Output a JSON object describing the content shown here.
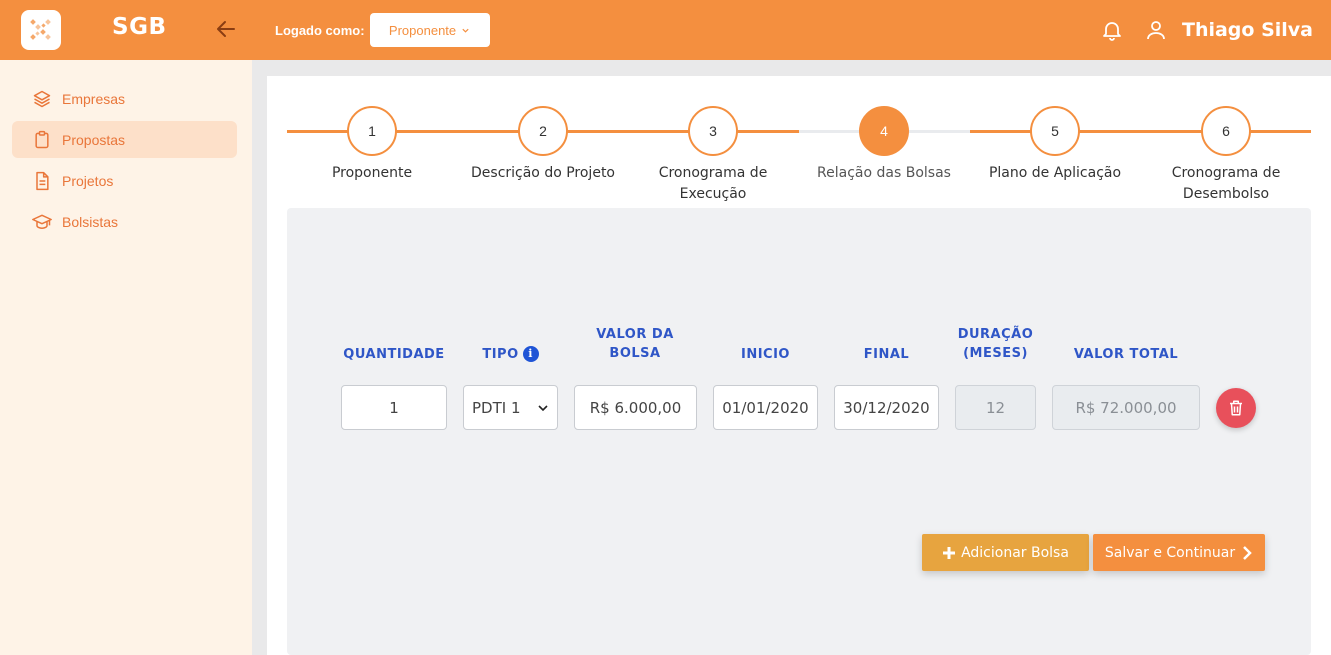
{
  "app": {
    "name": "SGB"
  },
  "sidebar": {
    "items": [
      {
        "label": "Empresas",
        "icon": "layers-icon",
        "active": false
      },
      {
        "label": "Propostas",
        "icon": "clipboard-icon",
        "active": true
      },
      {
        "label": "Projetos",
        "icon": "document-icon",
        "active": false
      },
      {
        "label": "Bolsistas",
        "icon": "graduation-cap-icon",
        "active": false
      }
    ]
  },
  "topbar": {
    "logged_label": "Logado como:",
    "role": "Proponente",
    "user_name": "Thiago Silva"
  },
  "stepper": {
    "steps": [
      {
        "number": "1",
        "label": "Proponente"
      },
      {
        "number": "2",
        "label": "Descrição do Projeto"
      },
      {
        "number": "3",
        "label": "Cronograma de Execução"
      },
      {
        "number": "4",
        "label": "Relação das Bolsas",
        "active": true
      },
      {
        "number": "5",
        "label": "Plano de Aplicação"
      },
      {
        "number": "6",
        "label": "Cronograma de Desembolso"
      }
    ]
  },
  "table": {
    "headers": {
      "quantidade": "QUANTIDADE",
      "tipo": "TIPO",
      "valor_bolsa": "VALOR DA BOLSA",
      "inicio": "INICIO",
      "final": "FINAL",
      "duracao": "DURAÇÃO (MESES)",
      "valor_total": "VALOR TOTAL"
    },
    "row": {
      "quantidade": "1",
      "tipo": "PDTI 1",
      "valor_bolsa": "R$ 6.000,00",
      "inicio": "01/01/2020",
      "final": "30/12/2020",
      "duracao": "12",
      "valor_total": "R$ 72.000,00"
    }
  },
  "buttons": {
    "add": "Adicionar Bolsa",
    "save": "Salvar e Continuar"
  },
  "colors": {
    "accent": "#f48f3f",
    "header_blue": "#2f56c7",
    "delete": "#e8505b",
    "add_button": "#e7a43f"
  }
}
